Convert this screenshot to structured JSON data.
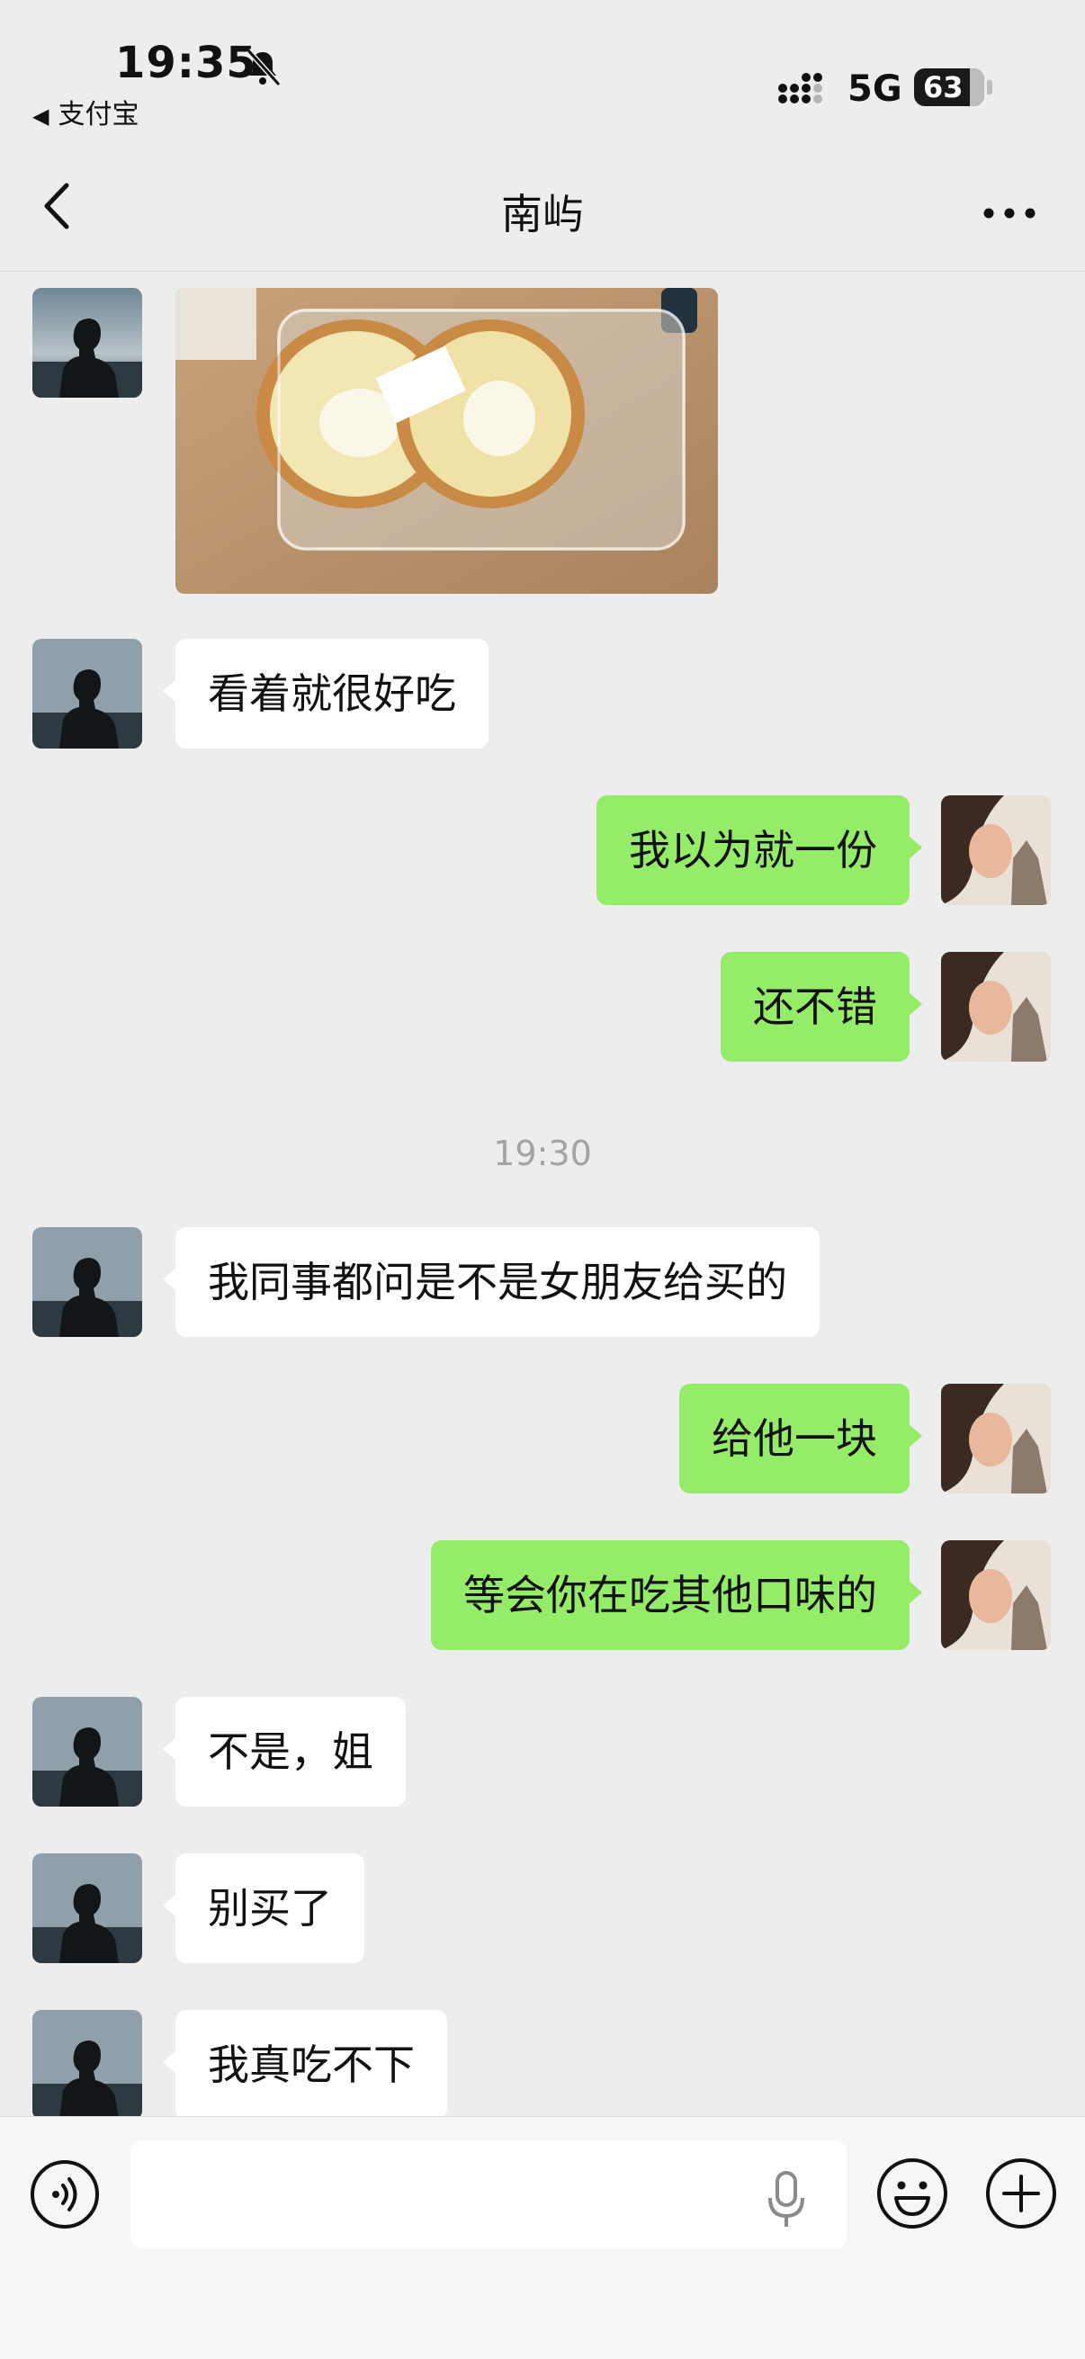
{
  "status_bar": {
    "time": "19:35",
    "back_app": "支付宝",
    "network": "5G",
    "battery": "63"
  },
  "nav": {
    "title": "南屿"
  },
  "messages": [
    {
      "from": "them",
      "type": "image",
      "icon": "cake-roll-photo"
    },
    {
      "from": "them",
      "type": "text",
      "text": "看着就很好吃"
    },
    {
      "from": "me",
      "type": "text",
      "text": "我以为就一份"
    },
    {
      "from": "me",
      "type": "text",
      "text": "还不错"
    },
    {
      "type": "timestamp",
      "text": "19:30"
    },
    {
      "from": "them",
      "type": "text",
      "text": "我同事都问是不是女朋友给买的"
    },
    {
      "from": "me",
      "type": "text",
      "text": "给他一块"
    },
    {
      "from": "me",
      "type": "text",
      "text": "等会你在吃其他口味的"
    },
    {
      "from": "them",
      "type": "text",
      "text": "不是，姐"
    },
    {
      "from": "them",
      "type": "text",
      "text": "别买了"
    },
    {
      "from": "them",
      "type": "text",
      "text": "我真吃不下"
    }
  ],
  "input_bar": {
    "value": "",
    "placeholder": ""
  },
  "colors": {
    "background": "#ededed",
    "incoming_bubble": "#ffffff",
    "outgoing_bubble": "#95ec69",
    "timestamp": "#a3a3a3"
  }
}
